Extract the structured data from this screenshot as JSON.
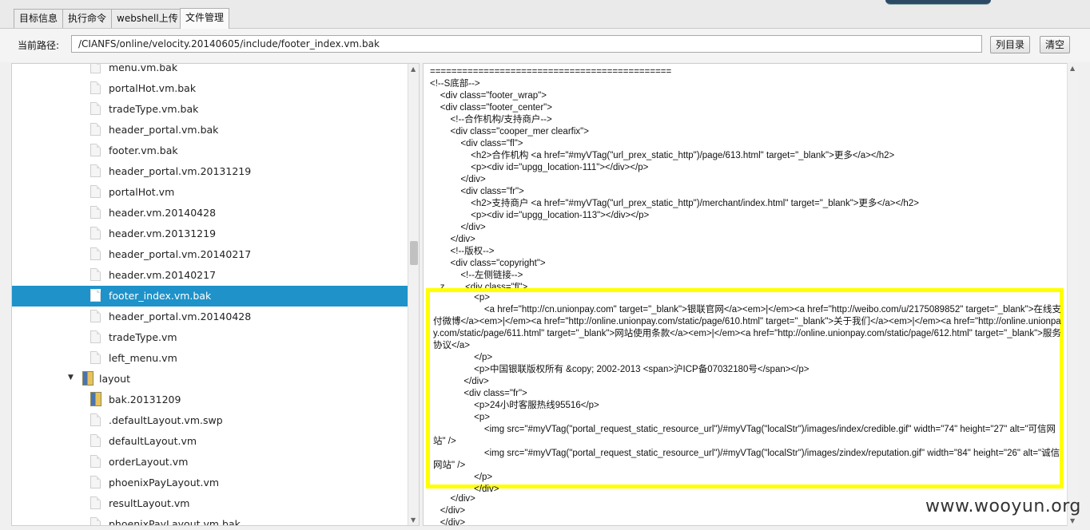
{
  "tabs": [
    {
      "label": "目标信息"
    },
    {
      "label": "执行命令"
    },
    {
      "label": "webshell上传"
    },
    {
      "label": "文件管理"
    }
  ],
  "path": {
    "label": "当前路径:",
    "value": "/CIANFS/online/velocity.20140605/include/footer_index.vm.bak",
    "list_button": "列目录",
    "clear_button": "清空"
  },
  "tree": {
    "items": [
      {
        "label": "menu.vm.bak",
        "type": "file"
      },
      {
        "label": "portalHot.vm.bak",
        "type": "file"
      },
      {
        "label": "tradeType.vm.bak",
        "type": "file"
      },
      {
        "label": "header_portal.vm.bak",
        "type": "file"
      },
      {
        "label": "footer.vm.bak",
        "type": "file"
      },
      {
        "label": "header_portal.vm.20131219",
        "type": "file"
      },
      {
        "label": "portalHot.vm",
        "type": "file"
      },
      {
        "label": "header.vm.20140428",
        "type": "file"
      },
      {
        "label": "header.vm.20131219",
        "type": "file"
      },
      {
        "label": "header_portal.vm.20140217",
        "type": "file"
      },
      {
        "label": "header.vm.20140217",
        "type": "file"
      },
      {
        "label": "footer_index.vm.bak",
        "type": "file",
        "selected": true
      },
      {
        "label": "header_portal.vm.20140428",
        "type": "file"
      },
      {
        "label": "tradeType.vm",
        "type": "file"
      },
      {
        "label": "left_menu.vm",
        "type": "file"
      },
      {
        "label": "layout",
        "type": "folder"
      },
      {
        "label": "bak.20131209",
        "type": "folder"
      },
      {
        "label": ".defaultLayout.vm.swp",
        "type": "file"
      },
      {
        "label": "defaultLayout.vm",
        "type": "file"
      },
      {
        "label": "orderLayout.vm",
        "type": "file"
      },
      {
        "label": "phoenixPayLayout.vm",
        "type": "file"
      },
      {
        "label": "resultLayout.vm",
        "type": "file"
      },
      {
        "label": "phoenixPayLayout.vm.bak",
        "type": "file"
      }
    ]
  },
  "code": {
    "top_lines": [
      "=============================================",
      "<!--S底部-->",
      "    <div class=\"footer_wrap\">",
      "    <div class=\"footer_center\">",
      "        <!--合作机构/支持商户-->",
      "        <div class=\"cooper_mer clearfix\">",
      "            <div class=\"fl\">",
      "                <h2>合作机构 <a href=\"#myVTag(\"url_prex_static_http\")/page/613.html\" target=\"_blank\">更多</a></h2>",
      "                <p><div id=\"upgg_location-111\"></div></p>",
      "            </div>",
      "            <div class=\"fr\">",
      "                <h2>支持商户 <a href=\"#myVTag(\"url_prex_static_http\")/merchant/index.html\" target=\"_blank\">更多</a></h2>",
      "                <p><div id=\"upgg_location-113\"></div></p>",
      "            </div>",
      "        </div>",
      "        <!--版权-->",
      "        <div class=\"copyright\">",
      "            <!--左侧链接-->",
      "    z        <div class=\"fl\">"
    ],
    "highlight_lines": [
      "                <p>",
      "                    <a href=\"http://cn.unionpay.com\" target=\"_blank\">银联官网</a><em>|</em><a href=\"http://weibo.com/u/2175089852\" target=\"_blank\">在线支付微博</a><em>|</em><a href=\"http://online.unionpay.com/static/page/610.html\" target=\"_blank\">关于我们</a><em>|</em><a href=\"http://online.unionpay.com/static/page/611.html\" target=\"_blank\">网站使用条款</a><em>|</em><a href=\"http://online.unionpay.com/static/page/612.html\" target=\"_blank\">服务协议</a>",
      "                </p>",
      "                <p>中国银联版权所有 &copy; 2002-2013 <span>沪ICP备07032180号</span></p>",
      "            </div>",
      "            <div class=\"fr\">",
      "                <p>24小时客服热线95516</p>",
      "                <p>",
      "                    <img src=\"#myVTag(\"portal_request_static_resource_url\")/#myVTag(\"localStr\")/images/index/credible.gif\" width=\"74\" height=\"27\" alt=\"可信网站\" />",
      "                    <img src=\"#myVTag(\"portal_request_static_resource_url\")/#myVTag(\"localStr\")/images/zindex/reputation.gif\" width=\"84\" height=\"26\" alt=\"诚信网站\" />",
      "                </p>",
      "                </div>"
    ],
    "bottom_lines": [
      "        </div>",
      "    </div>",
      "    </div>"
    ]
  },
  "watermark": "www.wooyun.org"
}
